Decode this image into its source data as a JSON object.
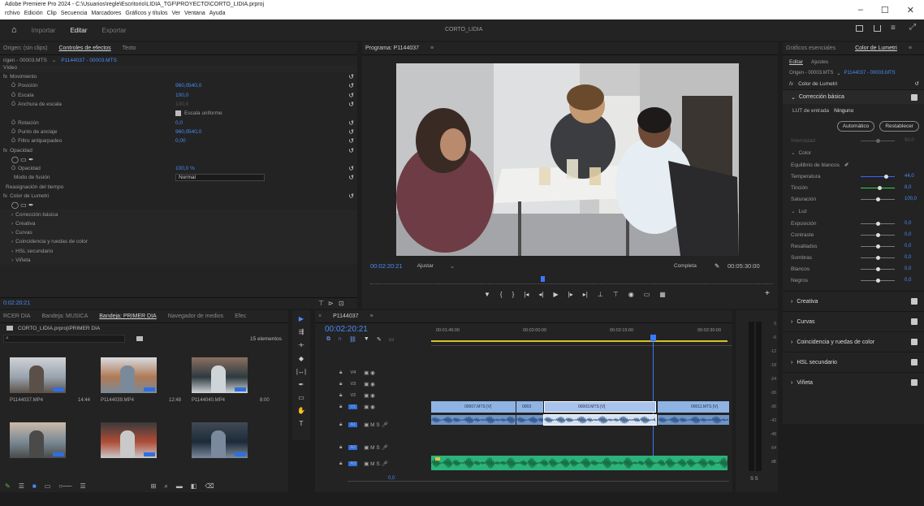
{
  "window": {
    "title": "Adobe Premiere Pro 2024 - C:\\Usuarios\\regle\\Escritorio\\LIDIA_TGF\\PROYECTO\\CORTO_LIDIA.prproj",
    "minimize": "–",
    "maximize": "☐",
    "close": "✕"
  },
  "menu": [
    "rchivo",
    "Edición",
    "Clip",
    "Secuencia",
    "Marcadores",
    "Gráficos y títulos",
    "Ver",
    "Ventana",
    "Ayuda"
  ],
  "workspaces": {
    "import": "Importar",
    "edit": "Editar",
    "export": "Exportar",
    "project_name": "CORTO_LIDIA"
  },
  "effect_controls": {
    "tabs": [
      "Origen: (sin clips)",
      "Controles de efectos",
      "Texto"
    ],
    "active_tab": "Controles de efectos",
    "source": "rigen - 00003.MTS",
    "sequence": "P1144037 - 00003.MTS",
    "section": "Vídeo",
    "rows": [
      {
        "label": "Movimiento",
        "value": "",
        "value2": ""
      },
      {
        "label": "Posición",
        "value": "960,0",
        "value2": "540,0"
      },
      {
        "label": "Escala",
        "value": "100,0",
        "value2": ""
      },
      {
        "label": "Anchura de escala",
        "value": "100,0",
        "value2": ""
      },
      {
        "label": "",
        "value": "Escala uniforme",
        "value2": ""
      },
      {
        "label": "Rotación",
        "value": "0,0",
        "value2": ""
      },
      {
        "label": "Punto de anclaje",
        "value": "960,0",
        "value2": "540,0"
      },
      {
        "label": "Filtro antiparpadeo",
        "value": "0,00",
        "value2": ""
      },
      {
        "label": "Opacidad",
        "value": "",
        "value2": ""
      },
      {
        "label": "",
        "value": "",
        "value2": ""
      },
      {
        "label": "Opacidad",
        "value": "100,0 %",
        "value2": ""
      },
      {
        "label": "Modo de fusión",
        "value": "Normal",
        "value2": ""
      },
      {
        "label": "Reasignación del tiempo",
        "value": "",
        "value2": ""
      },
      {
        "label": "Color de Lumetri",
        "value": "",
        "value2": ""
      },
      {
        "label": "",
        "value": "",
        "value2": ""
      },
      {
        "label": "Corrección básica",
        "value": "",
        "value2": ""
      },
      {
        "label": "Creativa",
        "value": "",
        "value2": ""
      },
      {
        "label": "Curvas",
        "value": "",
        "value2": ""
      },
      {
        "label": "Coincidencia y ruedas de color",
        "value": "",
        "value2": ""
      },
      {
        "label": "HSL secundario",
        "value": "",
        "value2": ""
      },
      {
        "label": "Viñeta",
        "value": "",
        "value2": ""
      }
    ],
    "timecode": "0:02:20:21"
  },
  "program": {
    "title": "Programa: P1144037",
    "timecode": "00:02:20:21",
    "fit": "Ajustar",
    "quality": "Completa",
    "duration": "00:05:30:00"
  },
  "bins": {
    "tabs": [
      "RCER DIA",
      "Bandeja: MUSICA",
      "Bandeja: PRIMER DIA",
      "Navegador de medios",
      "Efec"
    ],
    "active_tab": "Bandeja: PRIMER DIA",
    "path": "CORTO_LIDIA.prproj\\PRIMER DIA",
    "count": "15 elementos",
    "items": [
      {
        "name": "P1144037.MP4",
        "duration": "14:44"
      },
      {
        "name": "P1144039.MP4",
        "duration": "12:48"
      },
      {
        "name": "P1144040.MP4",
        "duration": "8:00"
      },
      {
        "name": "",
        "duration": ""
      },
      {
        "name": "",
        "duration": ""
      },
      {
        "name": "",
        "duration": ""
      }
    ]
  },
  "timeline": {
    "title": "P1144037",
    "timecode": "00:02:20:21",
    "rulers": [
      "00:01:45:00",
      "00:02:00:00",
      "00:02:15:00",
      "00:02:30:00"
    ],
    "video_tracks": [
      "V4",
      "V3",
      "V2",
      "V1"
    ],
    "audio_tracks": [
      "A1",
      "A2",
      "A3"
    ],
    "clips": [
      "00007.MTS [V]",
      "0003",
      "00003.MTS [V]",
      "00011.MTS [V]"
    ],
    "footer": "0,0",
    "meter_labels": [
      "0",
      "-6",
      "-12",
      "-18",
      "-24",
      "-30",
      "-36",
      "-42",
      "-48",
      "-54",
      "dB"
    ],
    "meter_footer": "S S"
  },
  "lumetri": {
    "tabs": [
      "Gráficos esenciales",
      "Color de Lumetri"
    ],
    "active_tab": "Color de Lumetri",
    "subtabs": [
      "Editar",
      "Ajustes"
    ],
    "source": "Origen - 00003.MTS",
    "sequence": "P1144037 - 00003.MTS",
    "effect": "Color de Lumetri",
    "basic": "Corrección básica",
    "lut_label": "LUT de entrada",
    "lut_value": "Ninguno",
    "auto": "Automático",
    "reset": "Restablecer",
    "intensity": "Intensidad",
    "intensity_value": "50,0",
    "color": "Color",
    "wb": "Equilibrio de blancos",
    "sliders1": [
      {
        "label": "Temperatura",
        "value": "44,0",
        "pos": 0.75,
        "color": "#3a63ff"
      },
      {
        "label": "Tinción",
        "value": "8,0",
        "pos": 0.55,
        "color": "#32d24a"
      },
      {
        "label": "Saturación",
        "value": "100,0",
        "pos": 0.5,
        "color": "#777"
      }
    ],
    "light": "Luz",
    "sliders2": [
      {
        "label": "Exposición",
        "value": "0,0",
        "pos": 0.5
      },
      {
        "label": "Contraste",
        "value": "0,0",
        "pos": 0.5
      },
      {
        "label": "Resaltados",
        "value": "0,0",
        "pos": 0.5
      },
      {
        "label": "Sombras",
        "value": "0,0",
        "pos": 0.5
      },
      {
        "label": "Blancos",
        "value": "0,0",
        "pos": 0.5
      },
      {
        "label": "Negros",
        "value": "0,0",
        "pos": 0.5
      }
    ],
    "sections": [
      "Creativa",
      "Curvas",
      "Coincidencia y ruedas de color",
      "HSL secundario",
      "Viñeta"
    ]
  }
}
